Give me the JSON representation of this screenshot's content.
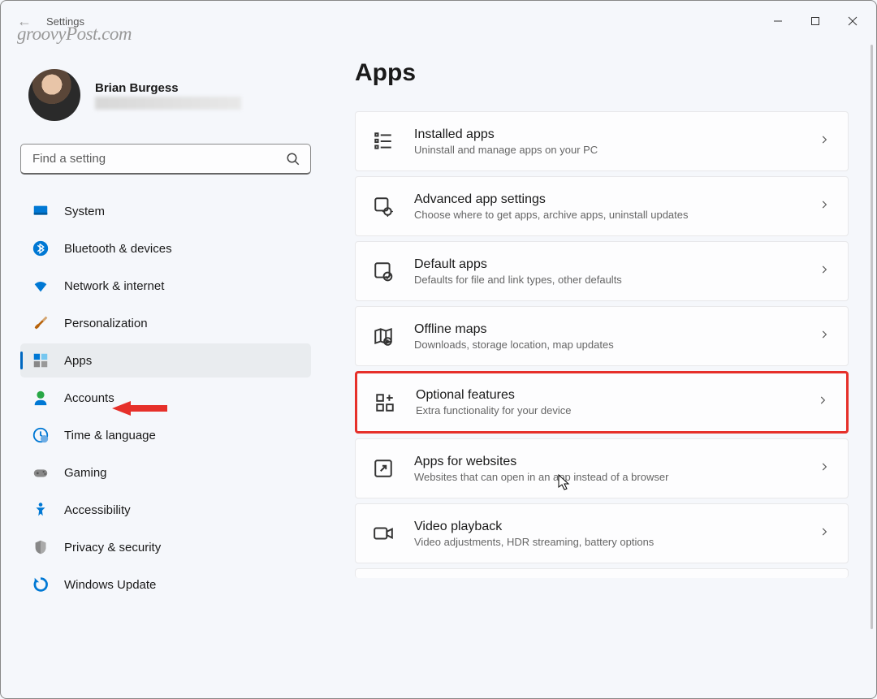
{
  "watermark": "groovyPost.com",
  "window": {
    "title": "Settings"
  },
  "profile": {
    "name": "Brian Burgess"
  },
  "search": {
    "placeholder": "Find a setting"
  },
  "nav": [
    {
      "id": "system",
      "label": "System",
      "active": false
    },
    {
      "id": "bluetooth",
      "label": "Bluetooth & devices",
      "active": false
    },
    {
      "id": "network",
      "label": "Network & internet",
      "active": false
    },
    {
      "id": "personalization",
      "label": "Personalization",
      "active": false
    },
    {
      "id": "apps",
      "label": "Apps",
      "active": true
    },
    {
      "id": "accounts",
      "label": "Accounts",
      "active": false
    },
    {
      "id": "time",
      "label": "Time & language",
      "active": false
    },
    {
      "id": "gaming",
      "label": "Gaming",
      "active": false
    },
    {
      "id": "accessibility",
      "label": "Accessibility",
      "active": false
    },
    {
      "id": "privacy",
      "label": "Privacy & security",
      "active": false
    },
    {
      "id": "update",
      "label": "Windows Update",
      "active": false
    }
  ],
  "page": {
    "title": "Apps"
  },
  "cards": [
    {
      "id": "installed",
      "title": "Installed apps",
      "desc": "Uninstall and manage apps on your PC",
      "highlight": false
    },
    {
      "id": "advanced",
      "title": "Advanced app settings",
      "desc": "Choose where to get apps, archive apps, uninstall updates",
      "highlight": false
    },
    {
      "id": "default",
      "title": "Default apps",
      "desc": "Defaults for file and link types, other defaults",
      "highlight": false
    },
    {
      "id": "offline",
      "title": "Offline maps",
      "desc": "Downloads, storage location, map updates",
      "highlight": false
    },
    {
      "id": "optional",
      "title": "Optional features",
      "desc": "Extra functionality for your device",
      "highlight": true
    },
    {
      "id": "websites",
      "title": "Apps for websites",
      "desc": "Websites that can open in an app instead of a browser",
      "highlight": false
    },
    {
      "id": "video",
      "title": "Video playback",
      "desc": "Video adjustments, HDR streaming, battery options",
      "highlight": false
    }
  ]
}
